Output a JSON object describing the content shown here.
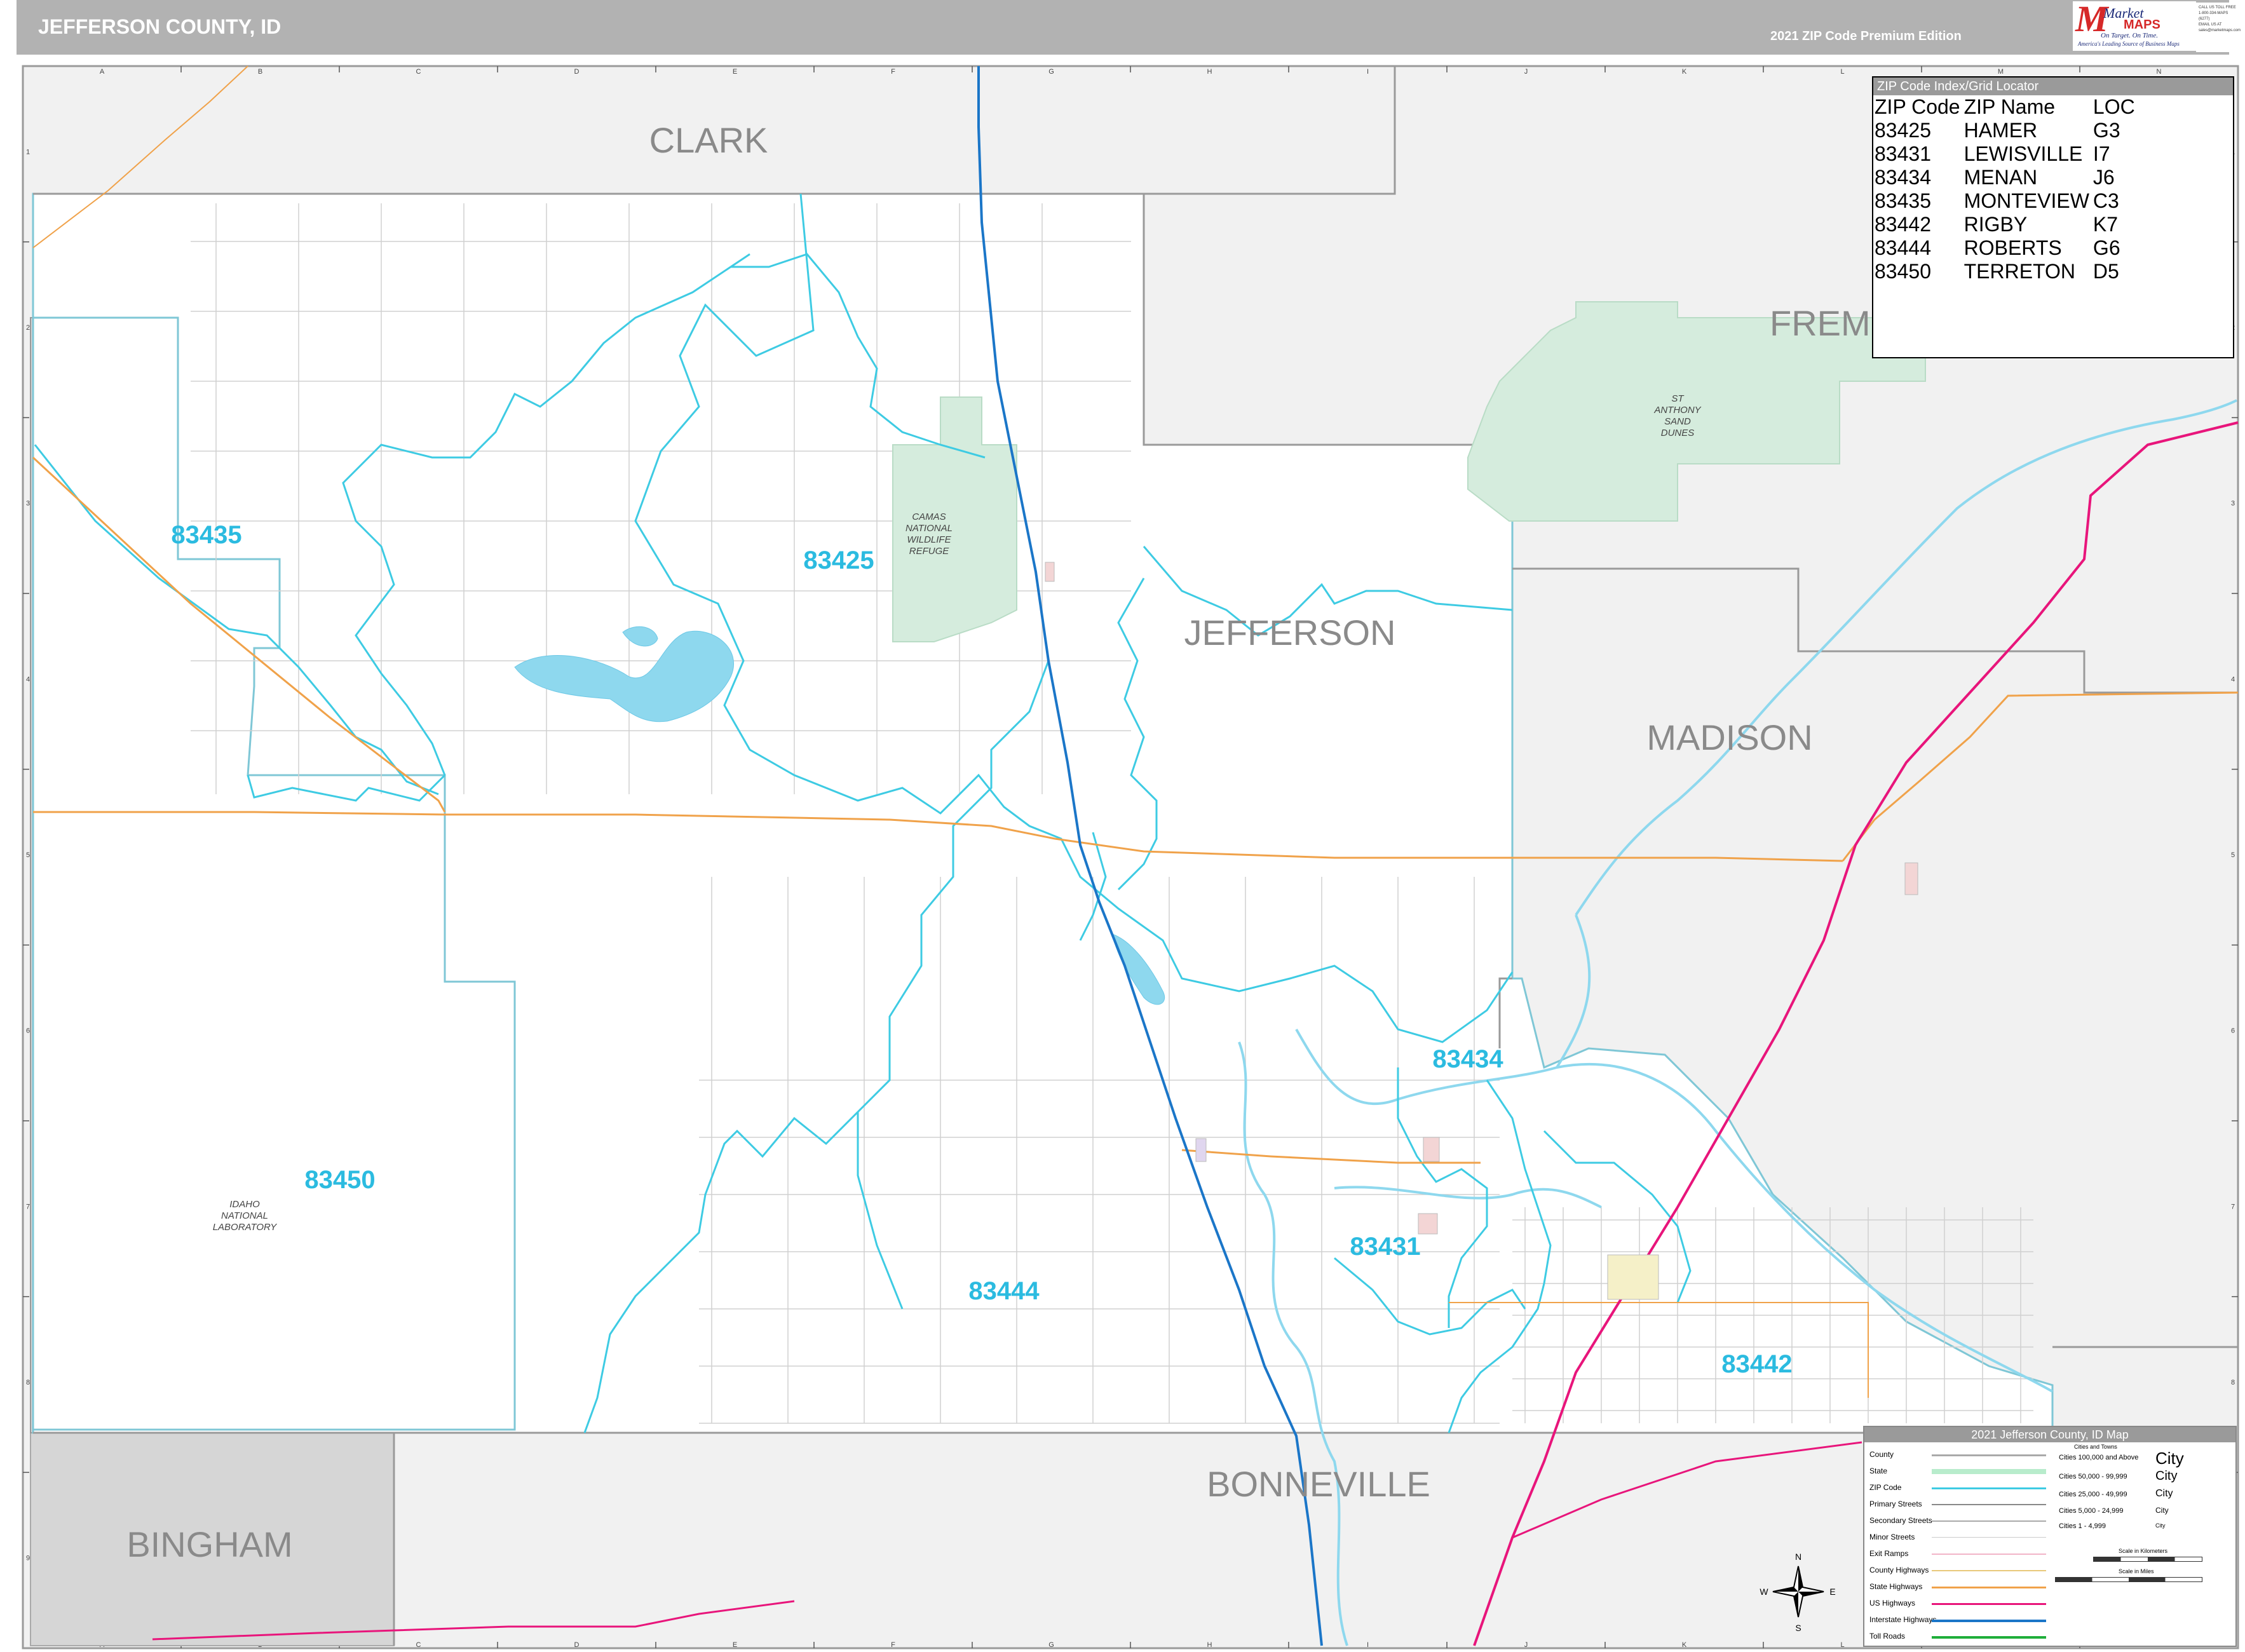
{
  "header": {
    "title": "JEFFERSON COUNTY, ID",
    "edition": "2021 ZIP Code Premium Edition",
    "logo": {
      "letter": "M",
      "word1": "Market",
      "word2": "MAPS",
      "tagline": "On Target. On Time.",
      "tagline2": "America's Leading Source of Business Maps"
    },
    "contact": [
      "CALL US TOLL FREE",
      "1-800-334-MAPS (6277)",
      "EMAIL US AT",
      "sales@marketmaps.com"
    ]
  },
  "colors": {
    "header_bg": "#b2b2b2",
    "neighbor_fill": "#f1f1f1",
    "other_state_fill": "#d6d6d6",
    "zip_boundary": "#3ecbe3",
    "zip_label": "#2bbbe0",
    "interstate": "#1b76c8",
    "us_highway": "#e8157b",
    "state_highway": "#f0a24a",
    "water": "#8ed8ee",
    "park": "#d5ecdd"
  },
  "grid": {
    "columns": [
      "A",
      "B",
      "C",
      "D",
      "E",
      "F",
      "G",
      "H",
      "I",
      "J",
      "K",
      "L",
      "M",
      "N"
    ],
    "rows": [
      "1",
      "2",
      "3",
      "4",
      "5",
      "6",
      "7",
      "8",
      "9"
    ]
  },
  "counties": {
    "jefferson": "JEFFERSON",
    "clark": "CLARK",
    "fremont": "FREM",
    "madison": "MADISON",
    "bonneville": "BONNEVILLE",
    "bingham": "BINGHAM"
  },
  "zip_labels": [
    "83435",
    "83425",
    "83434",
    "83450",
    "83431",
    "83444",
    "83442"
  ],
  "place_labels": {
    "camas": [
      "CAMAS",
      "NATIONAL",
      "WILDLIFE",
      "REFUGE"
    ],
    "dunes": [
      "ST",
      "ANTHONY",
      "SAND",
      "DUNES"
    ],
    "inl": [
      "IDAHO",
      "NATIONAL",
      "LABORATORY"
    ]
  },
  "zip_index": {
    "title": "ZIP Code Index/Grid Locator",
    "headers": [
      "ZIP Code",
      "ZIP Name",
      "LOC"
    ],
    "rows": [
      [
        "83425",
        "HAMER",
        "G3"
      ],
      [
        "83431",
        "LEWISVILLE",
        "I7"
      ],
      [
        "83434",
        "MENAN",
        "J6"
      ],
      [
        "83435",
        "MONTEVIEW",
        "C3"
      ],
      [
        "83442",
        "RIGBY",
        "K7"
      ],
      [
        "83444",
        "ROBERTS",
        "G6"
      ],
      [
        "83450",
        "TERRETON",
        "D5"
      ]
    ]
  },
  "legend": {
    "title": "2021 Jefferson County, ID Map",
    "items": [
      "County",
      "State",
      "ZIP Code",
      "Primary Streets",
      "Secondary Streets",
      "Minor Streets",
      "Exit Ramps",
      "County Highways",
      "State Highways",
      "US Highways",
      "Interstate Highways",
      "Toll Roads"
    ],
    "cities_heading": "Cities and Towns",
    "city_classes": [
      "Cities 100,000 and Above",
      "Cities 50,000 - 99,999",
      "Cities 25,000 - 49,999",
      "Cities 5,000 - 24,999",
      "Cities 1 - 4,999"
    ],
    "city_sample": "City",
    "scale_km": "Scale in Kilometers",
    "scale_mi": "Scale in Miles"
  },
  "compass": [
    "N",
    "E",
    "S",
    "W"
  ]
}
